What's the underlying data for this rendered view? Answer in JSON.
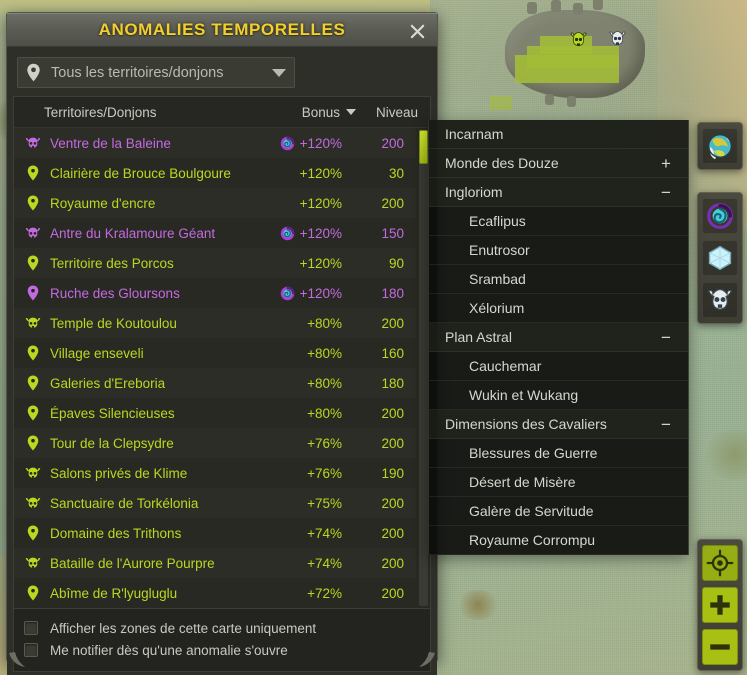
{
  "window": {
    "title": "ANOMALIES TEMPORELLES",
    "close_icon": "close-icon"
  },
  "selector": {
    "icon": "map-pin-icon",
    "value": "Tous les territoires/donjons",
    "caret_icon": "chevron-down-icon"
  },
  "table": {
    "headers": {
      "name": "Territoires/Donjons",
      "bonus": "Bonus",
      "level": "Niveau",
      "sort_icon": "sort-descending-icon"
    },
    "rows": [
      {
        "icon": "dungeon-skull-icon",
        "name": "Ventre de la Baleine",
        "vortex": true,
        "bonus": "+120%",
        "level": "200",
        "color": "purple"
      },
      {
        "icon": "map-pin-icon",
        "name": "Clairière de Brouce Boulgoure",
        "vortex": false,
        "bonus": "+120%",
        "level": "30",
        "color": "green"
      },
      {
        "icon": "map-pin-icon",
        "name": "Royaume d'encre",
        "vortex": false,
        "bonus": "+120%",
        "level": "200",
        "color": "green"
      },
      {
        "icon": "dungeon-skull-icon",
        "name": "Antre du Kralamoure Géant",
        "vortex": true,
        "bonus": "+120%",
        "level": "150",
        "color": "purple"
      },
      {
        "icon": "map-pin-icon",
        "name": "Territoire des Porcos",
        "vortex": false,
        "bonus": "+120%",
        "level": "90",
        "color": "green"
      },
      {
        "icon": "map-pin-icon",
        "name": "Ruche des Gloursons",
        "vortex": true,
        "bonus": "+120%",
        "level": "180",
        "color": "purple"
      },
      {
        "icon": "dungeon-skull-icon",
        "name": "Temple de Koutoulou",
        "vortex": false,
        "bonus": "+80%",
        "level": "200",
        "color": "green"
      },
      {
        "icon": "map-pin-icon",
        "name": "Village enseveli",
        "vortex": false,
        "bonus": "+80%",
        "level": "160",
        "color": "green"
      },
      {
        "icon": "map-pin-icon",
        "name": "Galeries d'Ereboria",
        "vortex": false,
        "bonus": "+80%",
        "level": "180",
        "color": "green"
      },
      {
        "icon": "map-pin-icon",
        "name": "Épaves Silencieuses",
        "vortex": false,
        "bonus": "+80%",
        "level": "200",
        "color": "green"
      },
      {
        "icon": "map-pin-icon",
        "name": "Tour de la Clepsydre",
        "vortex": false,
        "bonus": "+76%",
        "level": "200",
        "color": "green"
      },
      {
        "icon": "dungeon-skull-icon",
        "name": "Salons privés de Klime",
        "vortex": false,
        "bonus": "+76%",
        "level": "190",
        "color": "green"
      },
      {
        "icon": "dungeon-skull-icon",
        "name": "Sanctuaire de Torkélonia",
        "vortex": false,
        "bonus": "+75%",
        "level": "200",
        "color": "green"
      },
      {
        "icon": "map-pin-icon",
        "name": "Domaine des Trithons",
        "vortex": false,
        "bonus": "+74%",
        "level": "200",
        "color": "green"
      },
      {
        "icon": "dungeon-skull-icon",
        "name": "Bataille de l'Aurore Pourpre",
        "vortex": false,
        "bonus": "+74%",
        "level": "200",
        "color": "green"
      },
      {
        "icon": "map-pin-icon",
        "name": "Abîme de R'lyugluglu",
        "vortex": false,
        "bonus": "+72%",
        "level": "200",
        "color": "green"
      }
    ],
    "scrollbar": {
      "position": "top"
    }
  },
  "footer": {
    "options": [
      {
        "label": "Afficher les zones de cette carte uniquement",
        "checked": false
      },
      {
        "label": "Me notifier dès qu'une anomalie s'ouvre",
        "checked": false
      }
    ]
  },
  "flyout": {
    "items": [
      {
        "label": "Incarnam",
        "level": "group",
        "sign": ""
      },
      {
        "label": "Monde des Douze",
        "level": "group",
        "sign": "+"
      },
      {
        "label": "Ingloriom",
        "level": "group",
        "sign": "−"
      },
      {
        "label": "Ecaflipus",
        "level": "child",
        "sign": ""
      },
      {
        "label": "Enutrosor",
        "level": "child",
        "sign": ""
      },
      {
        "label": "Srambad",
        "level": "child",
        "sign": ""
      },
      {
        "label": "Xélorium",
        "level": "child",
        "sign": ""
      },
      {
        "label": "Plan Astral",
        "level": "group",
        "sign": "−"
      },
      {
        "label": "Cauchemar",
        "level": "child",
        "sign": ""
      },
      {
        "label": "Wukin et Wukang",
        "level": "child",
        "sign": ""
      },
      {
        "label": "Dimensions des Cavaliers",
        "level": "group",
        "sign": "−"
      },
      {
        "label": "Blessures de Guerre",
        "level": "child",
        "sign": ""
      },
      {
        "label": "Désert de Misère",
        "level": "child",
        "sign": ""
      },
      {
        "label": "Galère de Servitude",
        "level": "child",
        "sign": ""
      },
      {
        "label": "Royaume Corrompu",
        "level": "child",
        "sign": ""
      }
    ]
  },
  "toolbars": {
    "top": [
      {
        "icon": "world-globe-icon"
      }
    ],
    "mid": [
      {
        "icon": "temporal-vortex-icon"
      },
      {
        "icon": "crystal-hex-icon"
      },
      {
        "icon": "dungeon-skull-icon"
      }
    ],
    "bottom": [
      {
        "icon": "center-target-icon"
      },
      {
        "icon": "zoom-in-icon"
      },
      {
        "icon": "zoom-out-icon"
      }
    ]
  },
  "colors": {
    "accent_green": "#b9d920",
    "accent_purple": "#c46ae0",
    "title_gold": "#f2cf2e",
    "panel_bg": "#282923"
  }
}
